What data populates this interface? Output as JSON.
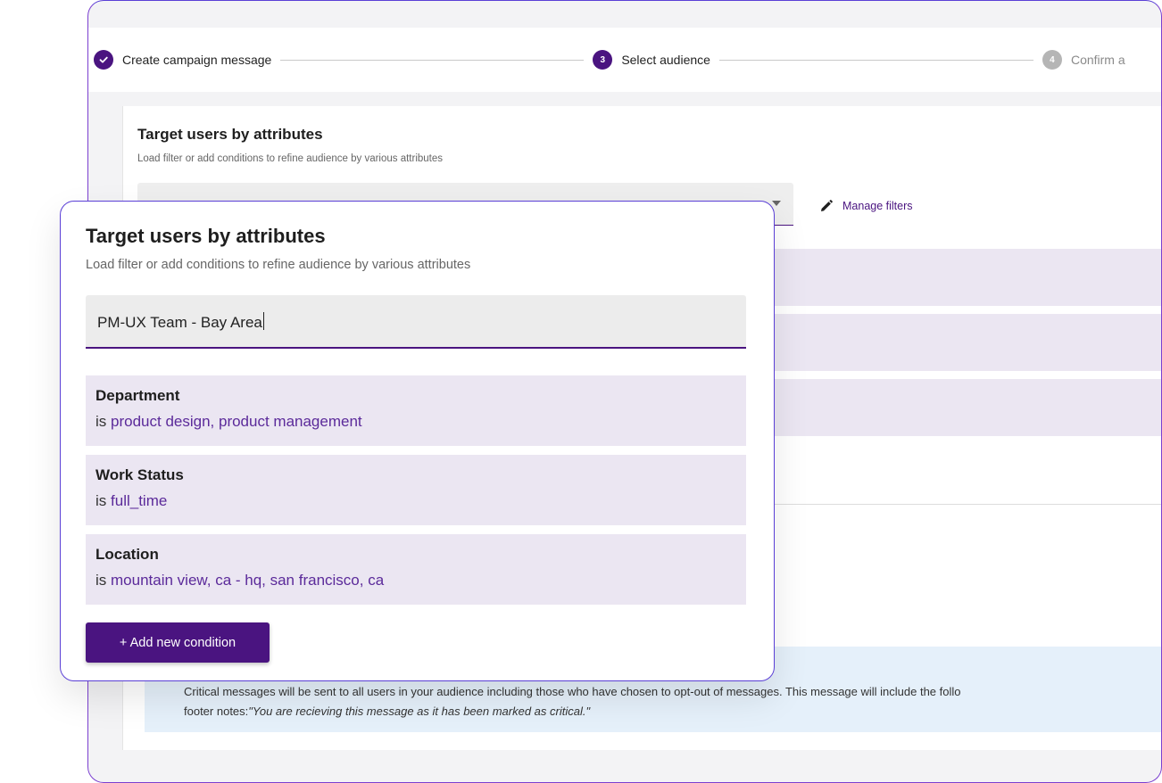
{
  "stepper": {
    "steps": [
      {
        "label": "Create campaign message",
        "state": "done",
        "marker": "✓"
      },
      {
        "label": "Select audience",
        "state": "active",
        "marker": "3"
      },
      {
        "label": "Confirm a",
        "state": "pending",
        "marker": "4"
      }
    ]
  },
  "background": {
    "title": "Target users by attributes",
    "subtitle": "Load filter or add conditions to refine audience by various attributes",
    "select_value": "PM-UX Team - Bay Area",
    "manage_filters_label": "Manage filters",
    "notice_text": "Critical messages will be sent to all users in your audience including those who have chosen to opt-out of messages. This message will include the follo",
    "notice_footer_prefix": "footer notes:",
    "notice_footer_quote": "\"You are recieving this message as it has been marked as critical.\""
  },
  "popup": {
    "title": "Target users by attributes",
    "subtitle": "Load filter or add conditions to refine audience by various attributes",
    "filter_input_value": "PM-UX Team - Bay Area",
    "conditions": [
      {
        "name": "Department",
        "operator": "is",
        "value": "product design, product management"
      },
      {
        "name": "Work Status",
        "operator": "is",
        "value": "full_time"
      },
      {
        "name": "Location",
        "operator": "is",
        "value": "mountain view, ca - hq, san francisco, ca"
      }
    ],
    "add_condition_label": "+ Add new condition"
  },
  "icons": {
    "check": "check-icon",
    "pencil": "pencil-icon",
    "caret": "caret-down-icon"
  },
  "colors": {
    "accent": "#4a1480",
    "condition_bg": "#ebe6f2",
    "value_text": "#5b2a9a",
    "notice_bg": "#e5f0fa",
    "window_border": "#5a3fd6"
  }
}
